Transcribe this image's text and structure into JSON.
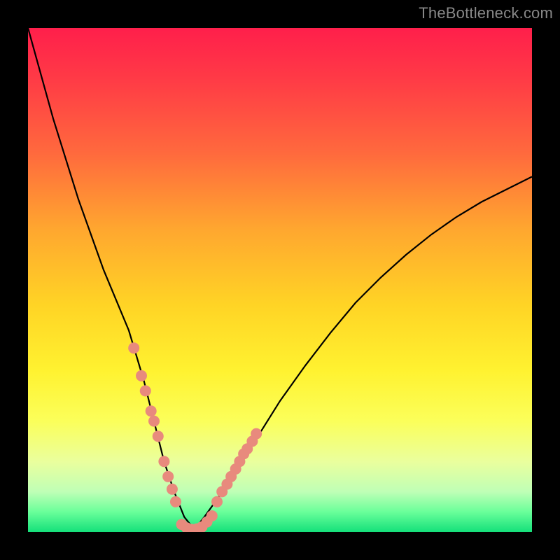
{
  "watermark": "TheBottleneck.com",
  "colors": {
    "dot": "#e88a7d",
    "curve": "#000000",
    "frame": "#000000"
  },
  "chart_data": {
    "type": "line",
    "title": "",
    "xlabel": "",
    "ylabel": "",
    "xlim": [
      0,
      100
    ],
    "ylim": [
      0,
      100
    ],
    "grid": false,
    "legend": false,
    "curve": {
      "x": [
        0,
        5,
        10,
        15,
        20,
        23,
        25,
        27,
        29,
        31,
        33,
        35,
        40,
        45,
        50,
        55,
        60,
        65,
        70,
        75,
        80,
        85,
        90,
        95,
        100
      ],
      "y": [
        100,
        82,
        66,
        52,
        40,
        30,
        22,
        14,
        8,
        3,
        0.5,
        3,
        10,
        18,
        26,
        33,
        39.5,
        45.5,
        50.5,
        55,
        59,
        62.5,
        65.5,
        68,
        70.5
      ]
    },
    "points_left": {
      "x": [
        21.0,
        22.5,
        23.3,
        24.4,
        25.0,
        25.8,
        27.0,
        27.8,
        28.6,
        29.3
      ],
      "y": [
        36.5,
        31.0,
        28.0,
        24.0,
        22.0,
        19.0,
        14.0,
        11.0,
        8.5,
        6.0
      ]
    },
    "points_right": {
      "x": [
        37.5,
        38.5,
        39.5,
        40.3,
        41.2,
        42.0,
        42.8,
        43.5,
        44.5,
        45.3
      ],
      "y": [
        6.0,
        8.0,
        9.5,
        11.0,
        12.5,
        14.0,
        15.5,
        16.5,
        18.0,
        19.5
      ]
    },
    "points_bottom": {
      "x": [
        30.5,
        31.5,
        32.5,
        33.5,
        34.5,
        35.5,
        36.5
      ],
      "y": [
        1.5,
        0.8,
        0.5,
        0.6,
        1.0,
        2.0,
        3.2
      ]
    },
    "background_gradient": {
      "top": "#ff1f4b",
      "orange": "#ff8a34",
      "yellow": "#fff230",
      "green": "#14e07a"
    }
  }
}
